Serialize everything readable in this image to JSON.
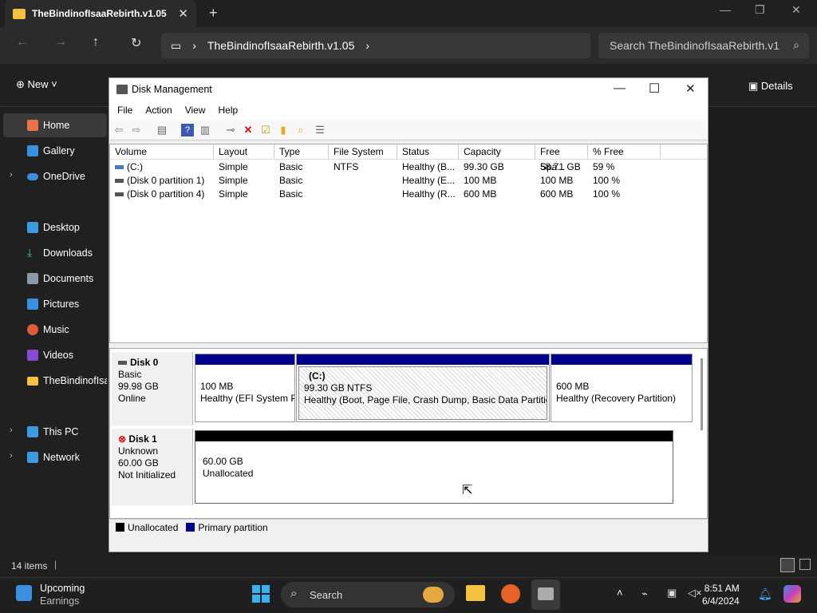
{
  "explorer": {
    "tab_title": "TheBindinofIsaaRebirth.v1.05",
    "breadcrumb": [
      "TheBindinofIsaaRebirth.v1.05"
    ],
    "search_placeholder": "Search TheBindinofIsaaRebirth.v1",
    "new_label": "New",
    "details_label": "Details",
    "sidebar": [
      {
        "label": "Home",
        "icon": "home-icon",
        "color": "#e8734a"
      },
      {
        "label": "Gallery",
        "icon": "gallery-icon",
        "color": "#3b8ee0"
      },
      {
        "label": "OneDrive",
        "icon": "cloud-icon",
        "color": "#3b8ee0"
      },
      {
        "label": "Desktop",
        "icon": "desktop-icon",
        "color": "#3b9de0"
      },
      {
        "label": "Downloads",
        "icon": "download-icon",
        "color": "#3bc98a"
      },
      {
        "label": "Documents",
        "icon": "document-icon",
        "color": "#8a9aa8"
      },
      {
        "label": "Pictures",
        "icon": "pictures-icon",
        "color": "#3b8ee0"
      },
      {
        "label": "Music",
        "icon": "music-icon",
        "color": "#e05a3b"
      },
      {
        "label": "Videos",
        "icon": "video-icon",
        "color": "#8a4ad0"
      },
      {
        "label": "TheBindinofIsa",
        "icon": "folder-icon",
        "color": "#f3c03f"
      },
      {
        "label": "This PC",
        "icon": "pc-icon",
        "color": "#3b9de0"
      },
      {
        "label": "Network",
        "icon": "network-icon",
        "color": "#3b9de0"
      }
    ],
    "items_count": "14 items"
  },
  "dm": {
    "title": "Disk Management",
    "menu": [
      "File",
      "Action",
      "View",
      "Help"
    ],
    "columns": [
      "Volume",
      "Layout",
      "Type",
      "File System",
      "Status",
      "Capacity",
      "Free Spa...",
      "% Free"
    ],
    "rows": [
      [
        "(C:)",
        "Simple",
        "Basic",
        "NTFS",
        "Healthy (B...",
        "99.30 GB",
        "58.71 GB",
        "59 %"
      ],
      [
        "(Disk 0 partition 1)",
        "Simple",
        "Basic",
        "",
        "Healthy (E...",
        "100 MB",
        "100 MB",
        "100 %"
      ],
      [
        "(Disk 0 partition 4)",
        "Simple",
        "Basic",
        "",
        "Healthy (R...",
        "600 MB",
        "600 MB",
        "100 %"
      ]
    ],
    "disk0": {
      "name": "Disk 0",
      "type": "Basic",
      "size": "99.98 GB",
      "state": "Online",
      "p1": {
        "size": "100 MB",
        "status": "Healthy (EFI System P"
      },
      "p2": {
        "name": "(C:)",
        "size": "99.30 GB NTFS",
        "status": "Healthy (Boot, Page File, Crash Dump, Basic Data Partition"
      },
      "p3": {
        "size": "600 MB",
        "status": "Healthy (Recovery Partition)"
      }
    },
    "disk1": {
      "name": "Disk 1",
      "type": "Unknown",
      "size": "60.00 GB",
      "state": "Not Initialized",
      "p1": {
        "size": "60.00 GB",
        "status": "Unallocated"
      }
    },
    "legend": [
      "Unallocated",
      "Primary partition"
    ],
    "colors": {
      "unallocated": "#000000",
      "primary": "#00008b"
    }
  },
  "taskbar": {
    "weather_title": "Upcoming",
    "weather_sub": "Earnings",
    "search_label": "Search",
    "time": "8:51 AM",
    "date": "6/4/2024"
  }
}
